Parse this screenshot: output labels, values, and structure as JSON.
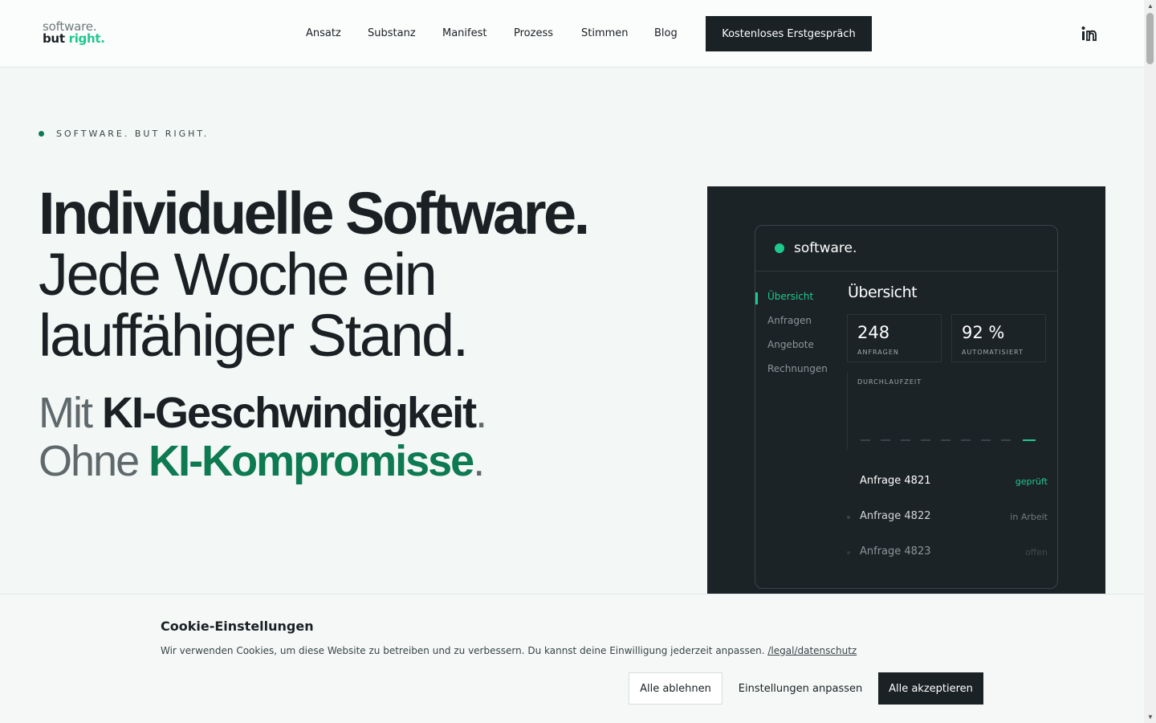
{
  "header": {
    "logo_line1": "software.",
    "logo_line2_a": "but ",
    "logo_line2_b": "right.",
    "nav": [
      "Ansatz",
      "Substanz",
      "Manifest",
      "Prozess",
      "Stimmen",
      "Blog"
    ],
    "cta_label": "Kostenloses Erstgespräch",
    "social_icon": "linkedin-icon"
  },
  "hero": {
    "eyebrow": "SOFTWARE. BUT RIGHT.",
    "h1_bold": "Individuelle Software.",
    "h1_line2": "Jede Woche ein",
    "h1_line3": "lauffähiger Stand.",
    "sub1_muted": "Mit ",
    "sub1_strong": "KI-Geschwindigkeit",
    "sub1_dot": ".",
    "sub2_muted": "Ohne ",
    "sub2_green": "KI-Kompromisse",
    "sub2_dot": "."
  },
  "dashboard": {
    "brand": "software.",
    "sidebar": [
      "Übersicht",
      "Anfragen",
      "Angebote",
      "Rechnungen"
    ],
    "title": "Übersicht",
    "stats": [
      {
        "value": "248",
        "label": "ANFRAGEN"
      },
      {
        "value": "92 %",
        "label": "AUTOMATISIERT"
      }
    ],
    "chart_label": "DURCHLAUFZEIT",
    "rows": [
      {
        "name": "Anfrage 4821",
        "status": "geprüft"
      },
      {
        "name": "Anfrage 4822",
        "status": "in Arbeit"
      },
      {
        "name": "Anfrage 4823",
        "status": "offen"
      }
    ]
  },
  "cookie": {
    "title": "Cookie-Einstellungen",
    "text": "Wir verwenden Cookies, um diese Website zu betreiben und zu verbessern. Du kannst deine Einwilligung jederzeit anpassen. ",
    "link": "/legal/datenschutz",
    "decline": "Alle ablehnen",
    "customize": "Einstellungen anpassen",
    "accept": "Alle akzeptieren"
  },
  "colors": {
    "accent_green": "#1ec98d",
    "dark_green": "#0d7a52",
    "dark_bg": "#1c2327"
  }
}
